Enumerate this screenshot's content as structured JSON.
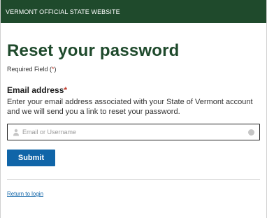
{
  "banner": {
    "text": "VERMONT OFFICIAL STATE WEBSITE"
  },
  "form": {
    "title": "Reset your password",
    "required_note_prefix": "Required Field (",
    "required_note_star": "*",
    "required_note_suffix": ")",
    "email_label": "Email address",
    "email_required_star": "*",
    "email_help": "Enter your email address associated with your State of Vermont account and we will send you a link to reset your password.",
    "email_input": {
      "value": "",
      "placeholder": "Email or Username"
    },
    "submit_label": "Submit",
    "return_link": "Return to login"
  },
  "colors": {
    "banner_bg": "#1f4a2c",
    "title": "#1f4a2c",
    "accent": "#1065a8",
    "required": "#c0392b"
  },
  "icons": {
    "input_left": "user-icon",
    "input_right": "clear-icon"
  }
}
